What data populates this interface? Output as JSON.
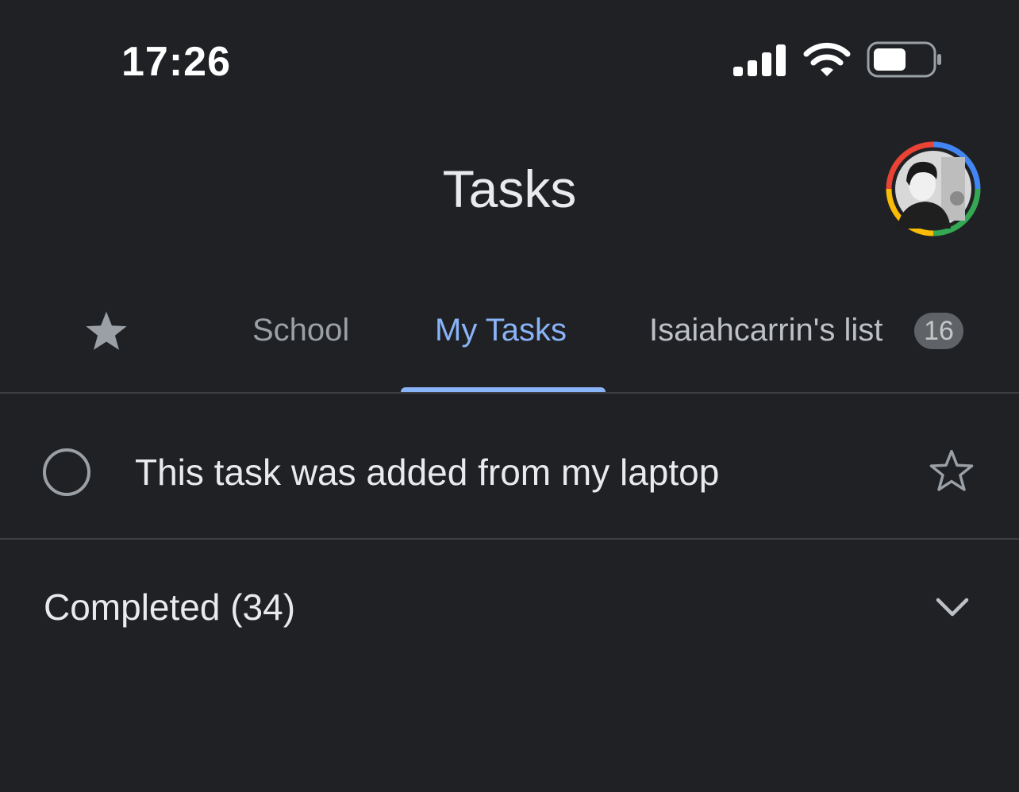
{
  "status_bar": {
    "time": "17:26",
    "icons": [
      "cellular-signal-icon",
      "wifi-icon",
      "battery-icon"
    ]
  },
  "header": {
    "title": "Tasks",
    "avatar": "account-avatar"
  },
  "tabs": {
    "starred_icon": "star-icon",
    "items": [
      {
        "label": "School",
        "selected": false
      },
      {
        "label": "My Tasks",
        "selected": true
      },
      {
        "label": "Isaiahcarrin's list",
        "selected": false,
        "badge": "16"
      }
    ]
  },
  "tasks": [
    {
      "title": "This task was added from my laptop",
      "starred": false
    }
  ],
  "completed": {
    "label": "Completed (34)",
    "icon": "chevron-down-icon"
  },
  "colors": {
    "background": "#202124",
    "accent": "#8ab4f8",
    "text_primary": "#e8eaed",
    "text_secondary": "#9aa0a6",
    "divider": "#3c4043",
    "badge": "#5f6368"
  }
}
